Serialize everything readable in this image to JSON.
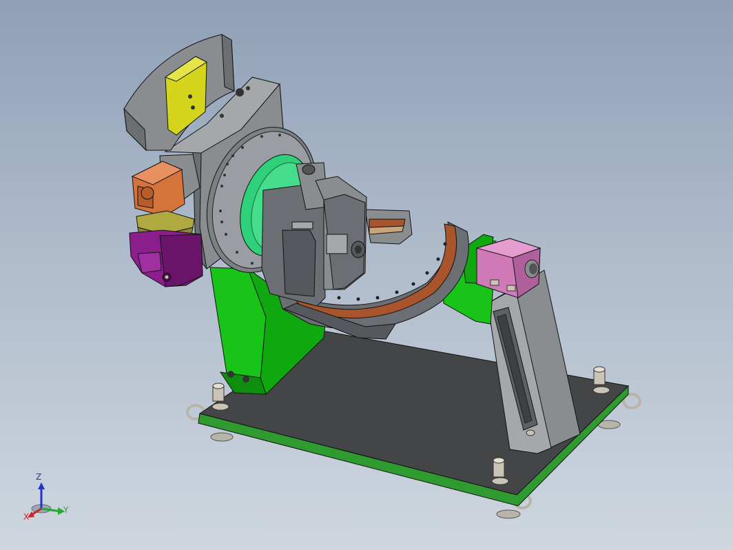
{
  "viewport": {
    "background_top": "#8fa0b6",
    "background_bottom": "#cfd6df"
  },
  "triad": {
    "z_label": "Z",
    "y_label": "Y",
    "x_label": "X",
    "z_color": "#2233cc",
    "y_color": "#22aa33",
    "x_color": "#cc2222"
  },
  "colors": {
    "base_plate_top": "#444546",
    "base_plate_side": "#2f9a2f",
    "green_support": "#18c418",
    "gray_body": "#8a8d90",
    "green_disc": "#2fd07a",
    "copper_arc": "#a8552e",
    "orange_motor": "#d4733a",
    "purple_motor": "#8a1e8a",
    "pink_block": "#d07ab8",
    "yellow_plate": "#d4d41c"
  }
}
